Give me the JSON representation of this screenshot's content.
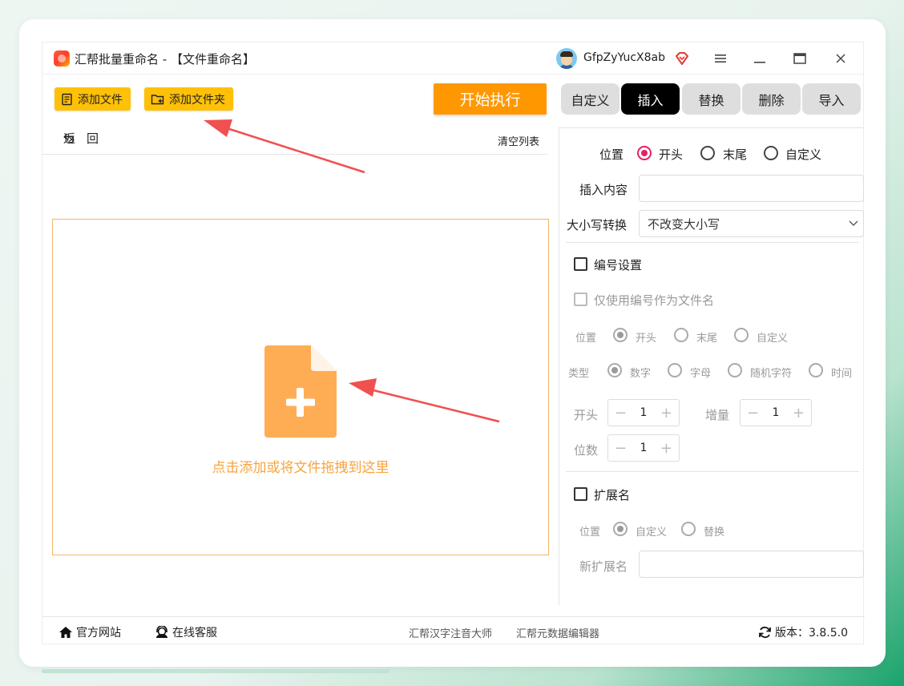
{
  "app": {
    "title": "汇帮批量重命名 - 【文件重命名】",
    "username": "GfpZyYucX8ab"
  },
  "toolbar": {
    "add_file": "添加文件",
    "add_folder": "添加文件夹",
    "start": "开始执行"
  },
  "tabs": [
    {
      "label": "自定义",
      "active": false
    },
    {
      "label": "插入",
      "active": true
    },
    {
      "label": "替换",
      "active": false
    },
    {
      "label": "删除",
      "active": false
    },
    {
      "label": "导入",
      "active": false
    }
  ],
  "list": {
    "back": "返回",
    "clear": "清空列表",
    "drop_hint": "点击添加或将文件拖拽到这里"
  },
  "insert": {
    "position_label": "位置",
    "position_options": [
      "开头",
      "末尾",
      "自定义"
    ],
    "position_selected": "开头",
    "content_label": "插入内容",
    "content_value": "",
    "case_label": "大小写转换",
    "case_value": "不改变大小写"
  },
  "numbering": {
    "label": "编号设置",
    "checked": false,
    "only_number_label": "仅使用编号作为文件名",
    "position_label": "位置",
    "position_options": [
      "开头",
      "末尾",
      "自定义"
    ],
    "position_selected": "开头",
    "type_label": "类型",
    "type_options": [
      "数字",
      "字母",
      "随机字符",
      "时间"
    ],
    "type_selected": "数字",
    "start_label": "开头",
    "start_value": "1",
    "increment_label": "增量",
    "increment_value": "1",
    "digits_label": "位数",
    "digits_value": "1"
  },
  "extension": {
    "label": "扩展名",
    "checked": false,
    "position_label": "位置",
    "position_options": [
      "自定义",
      "替换"
    ],
    "position_selected": "自定义",
    "new_ext_label": "新扩展名",
    "new_ext_value": ""
  },
  "statusbar": {
    "website": "官方网站",
    "support": "在线客服",
    "link1": "汇帮汉字注音大师",
    "link2": "汇帮元数据编辑器",
    "version": "版本：3.8.5.0"
  },
  "colors": {
    "accent_yellow": "#ffc107",
    "start_orange": "#ff9800",
    "radio_pink": "#e91e63",
    "drop_text": "#f7a43f",
    "file_icon": "#ffad55",
    "annotation_arrow": "#f0504f"
  }
}
